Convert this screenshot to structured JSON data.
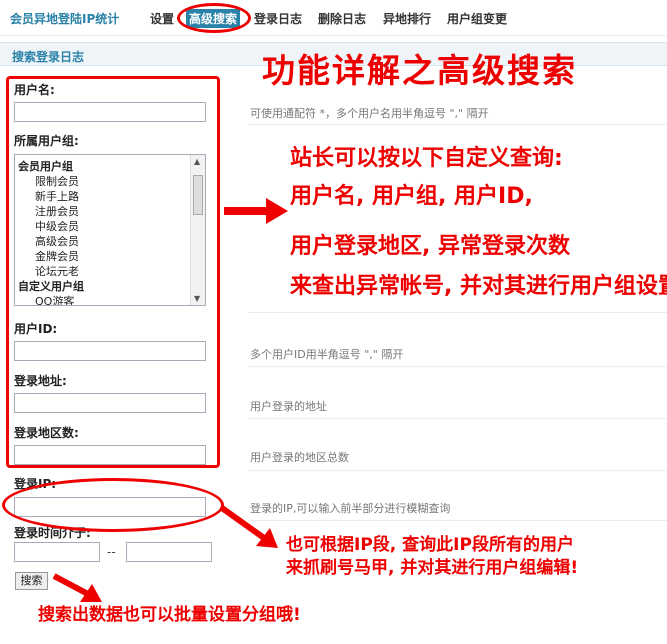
{
  "nav": {
    "brand": "会员异地登陆IP统计",
    "items": [
      "设置",
      "高级搜索",
      "登录日志",
      "删除日志",
      "异地排行",
      "用户组变更"
    ]
  },
  "section_title": "搜索登录日志",
  "form": {
    "username": {
      "label": "用户名:",
      "value": "",
      "hint": "可使用通配符 *，多个用户名用半角逗号 \",\" 隔开"
    },
    "usergroup": {
      "label": "所属用户组:",
      "options": [
        {
          "text": "会员用户组",
          "kind": "group"
        },
        {
          "text": "限制会员",
          "kind": "child"
        },
        {
          "text": "新手上路",
          "kind": "child"
        },
        {
          "text": "注册会员",
          "kind": "child"
        },
        {
          "text": "中级会员",
          "kind": "child"
        },
        {
          "text": "高级会员",
          "kind": "child"
        },
        {
          "text": "金牌会员",
          "kind": "child"
        },
        {
          "text": "论坛元老",
          "kind": "child"
        },
        {
          "text": "自定义用户组",
          "kind": "group"
        },
        {
          "text": "QQ游客",
          "kind": "child"
        }
      ]
    },
    "uid": {
      "label": "用户ID:",
      "value": "",
      "hint": "多个用户ID用半角逗号 \",\" 隔开"
    },
    "address": {
      "label": "登录地址:",
      "value": "",
      "hint": "用户登录的地址"
    },
    "region_count": {
      "label": "登录地区数:",
      "value": "",
      "hint": "用户登录的地区总数"
    },
    "ip": {
      "label": "登录IP:",
      "value": "",
      "hint": "登录的IP,可以输入前半部分进行模糊查询"
    },
    "time_range": {
      "label": "登录时间介于:",
      "from": "",
      "to": "",
      "separator": "--"
    },
    "search_button": "搜索"
  },
  "annotations": {
    "title": "功能详解之高级搜索",
    "lines": [
      "站长可以按以下自定义查询:",
      "用户名, 用户组, 用户ID,",
      "用户登录地区, 异常登录次数",
      "来查出异常帐号, 并对其进行用户组设置"
    ],
    "ip_lines": [
      "也可根据IP段, 查询此IP段所有的用户",
      "来抓刷号马甲, 并对其进行用户组编辑!"
    ],
    "bottom": "搜索出数据也可以批量设置分组哦!"
  },
  "colors": {
    "accent": "#2a82a8",
    "annotation": "#ee0000"
  }
}
